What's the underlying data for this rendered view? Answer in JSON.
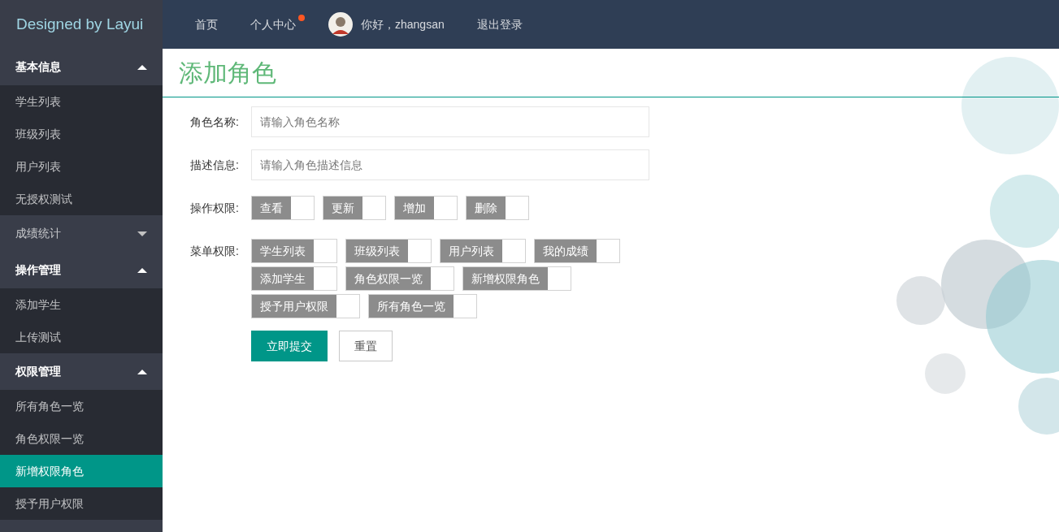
{
  "logo": "Designed by Layui",
  "top_nav": [
    {
      "kind": "link",
      "label": "首页",
      "badge": false
    },
    {
      "kind": "link",
      "label": "个人中心",
      "badge": true
    },
    {
      "kind": "user",
      "label": "你好，zhangsan",
      "badge": false
    },
    {
      "kind": "link",
      "label": "退出登录",
      "badge": false
    }
  ],
  "sidebar": [
    {
      "label": "基本信息",
      "expanded": true,
      "children": [
        {
          "label": "学生列表",
          "selected": false
        },
        {
          "label": "班级列表",
          "selected": false
        },
        {
          "label": "用户列表",
          "selected": false
        },
        {
          "label": "无授权测试",
          "selected": false
        }
      ]
    },
    {
      "label": "成绩统计",
      "expanded": false
    },
    {
      "label": "操作管理",
      "expanded": true,
      "children": [
        {
          "label": "添加学生",
          "selected": false
        },
        {
          "label": "上传测试",
          "selected": false
        }
      ]
    },
    {
      "label": "权限管理",
      "expanded": true,
      "children": [
        {
          "label": "所有角色一览",
          "selected": false
        },
        {
          "label": "角色权限一览",
          "selected": false
        },
        {
          "label": "新增权限角色",
          "selected": true
        },
        {
          "label": "授予用户权限",
          "selected": false
        }
      ]
    }
  ],
  "page_title": "添加角色",
  "form": {
    "fields": [
      {
        "label": "角色名称:",
        "placeholder": "请输入角色名称"
      },
      {
        "label": "描述信息:",
        "placeholder": "请输入角色描述信息"
      }
    ],
    "operation_permissions": {
      "label": "操作权限:",
      "options": [
        {
          "label": "查看",
          "checked": false
        },
        {
          "label": "更新",
          "checked": false
        },
        {
          "label": "增加",
          "checked": false
        },
        {
          "label": "删除",
          "checked": false
        }
      ]
    },
    "menu_permissions": {
      "label": "菜单权限:",
      "rows": [
        [
          {
            "label": "学生列表",
            "checked": false
          },
          {
            "label": "班级列表",
            "checked": false
          },
          {
            "label": "用户列表",
            "checked": false
          },
          {
            "label": "我的成绩",
            "checked": false
          }
        ],
        [
          {
            "label": "添加学生",
            "checked": false
          },
          {
            "label": "角色权限一览",
            "checked": false
          },
          {
            "label": "新增权限角色",
            "checked": false
          }
        ],
        [
          {
            "label": "授予用户权限",
            "checked": false
          },
          {
            "label": "所有角色一览",
            "checked": false
          }
        ]
      ]
    },
    "buttons": [
      {
        "kind": "primary",
        "label": "立即提交"
      },
      {
        "kind": "default",
        "label": "重置"
      }
    ]
  }
}
